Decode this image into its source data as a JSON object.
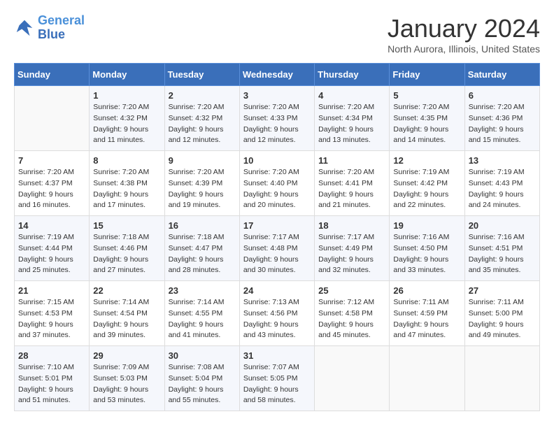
{
  "logo": {
    "line1": "General",
    "line2": "Blue"
  },
  "title": "January 2024",
  "location": "North Aurora, Illinois, United States",
  "days_header": [
    "Sunday",
    "Monday",
    "Tuesday",
    "Wednesday",
    "Thursday",
    "Friday",
    "Saturday"
  ],
  "weeks": [
    [
      {
        "num": "",
        "sunrise": "",
        "sunset": "",
        "daylight": ""
      },
      {
        "num": "1",
        "sunrise": "Sunrise: 7:20 AM",
        "sunset": "Sunset: 4:32 PM",
        "daylight": "Daylight: 9 hours and 11 minutes."
      },
      {
        "num": "2",
        "sunrise": "Sunrise: 7:20 AM",
        "sunset": "Sunset: 4:32 PM",
        "daylight": "Daylight: 9 hours and 12 minutes."
      },
      {
        "num": "3",
        "sunrise": "Sunrise: 7:20 AM",
        "sunset": "Sunset: 4:33 PM",
        "daylight": "Daylight: 9 hours and 12 minutes."
      },
      {
        "num": "4",
        "sunrise": "Sunrise: 7:20 AM",
        "sunset": "Sunset: 4:34 PM",
        "daylight": "Daylight: 9 hours and 13 minutes."
      },
      {
        "num": "5",
        "sunrise": "Sunrise: 7:20 AM",
        "sunset": "Sunset: 4:35 PM",
        "daylight": "Daylight: 9 hours and 14 minutes."
      },
      {
        "num": "6",
        "sunrise": "Sunrise: 7:20 AM",
        "sunset": "Sunset: 4:36 PM",
        "daylight": "Daylight: 9 hours and 15 minutes."
      }
    ],
    [
      {
        "num": "7",
        "sunrise": "Sunrise: 7:20 AM",
        "sunset": "Sunset: 4:37 PM",
        "daylight": "Daylight: 9 hours and 16 minutes."
      },
      {
        "num": "8",
        "sunrise": "Sunrise: 7:20 AM",
        "sunset": "Sunset: 4:38 PM",
        "daylight": "Daylight: 9 hours and 17 minutes."
      },
      {
        "num": "9",
        "sunrise": "Sunrise: 7:20 AM",
        "sunset": "Sunset: 4:39 PM",
        "daylight": "Daylight: 9 hours and 19 minutes."
      },
      {
        "num": "10",
        "sunrise": "Sunrise: 7:20 AM",
        "sunset": "Sunset: 4:40 PM",
        "daylight": "Daylight: 9 hours and 20 minutes."
      },
      {
        "num": "11",
        "sunrise": "Sunrise: 7:20 AM",
        "sunset": "Sunset: 4:41 PM",
        "daylight": "Daylight: 9 hours and 21 minutes."
      },
      {
        "num": "12",
        "sunrise": "Sunrise: 7:19 AM",
        "sunset": "Sunset: 4:42 PM",
        "daylight": "Daylight: 9 hours and 22 minutes."
      },
      {
        "num": "13",
        "sunrise": "Sunrise: 7:19 AM",
        "sunset": "Sunset: 4:43 PM",
        "daylight": "Daylight: 9 hours and 24 minutes."
      }
    ],
    [
      {
        "num": "14",
        "sunrise": "Sunrise: 7:19 AM",
        "sunset": "Sunset: 4:44 PM",
        "daylight": "Daylight: 9 hours and 25 minutes."
      },
      {
        "num": "15",
        "sunrise": "Sunrise: 7:18 AM",
        "sunset": "Sunset: 4:46 PM",
        "daylight": "Daylight: 9 hours and 27 minutes."
      },
      {
        "num": "16",
        "sunrise": "Sunrise: 7:18 AM",
        "sunset": "Sunset: 4:47 PM",
        "daylight": "Daylight: 9 hours and 28 minutes."
      },
      {
        "num": "17",
        "sunrise": "Sunrise: 7:17 AM",
        "sunset": "Sunset: 4:48 PM",
        "daylight": "Daylight: 9 hours and 30 minutes."
      },
      {
        "num": "18",
        "sunrise": "Sunrise: 7:17 AM",
        "sunset": "Sunset: 4:49 PM",
        "daylight": "Daylight: 9 hours and 32 minutes."
      },
      {
        "num": "19",
        "sunrise": "Sunrise: 7:16 AM",
        "sunset": "Sunset: 4:50 PM",
        "daylight": "Daylight: 9 hours and 33 minutes."
      },
      {
        "num": "20",
        "sunrise": "Sunrise: 7:16 AM",
        "sunset": "Sunset: 4:51 PM",
        "daylight": "Daylight: 9 hours and 35 minutes."
      }
    ],
    [
      {
        "num": "21",
        "sunrise": "Sunrise: 7:15 AM",
        "sunset": "Sunset: 4:53 PM",
        "daylight": "Daylight: 9 hours and 37 minutes."
      },
      {
        "num": "22",
        "sunrise": "Sunrise: 7:14 AM",
        "sunset": "Sunset: 4:54 PM",
        "daylight": "Daylight: 9 hours and 39 minutes."
      },
      {
        "num": "23",
        "sunrise": "Sunrise: 7:14 AM",
        "sunset": "Sunset: 4:55 PM",
        "daylight": "Daylight: 9 hours and 41 minutes."
      },
      {
        "num": "24",
        "sunrise": "Sunrise: 7:13 AM",
        "sunset": "Sunset: 4:56 PM",
        "daylight": "Daylight: 9 hours and 43 minutes."
      },
      {
        "num": "25",
        "sunrise": "Sunrise: 7:12 AM",
        "sunset": "Sunset: 4:58 PM",
        "daylight": "Daylight: 9 hours and 45 minutes."
      },
      {
        "num": "26",
        "sunrise": "Sunrise: 7:11 AM",
        "sunset": "Sunset: 4:59 PM",
        "daylight": "Daylight: 9 hours and 47 minutes."
      },
      {
        "num": "27",
        "sunrise": "Sunrise: 7:11 AM",
        "sunset": "Sunset: 5:00 PM",
        "daylight": "Daylight: 9 hours and 49 minutes."
      }
    ],
    [
      {
        "num": "28",
        "sunrise": "Sunrise: 7:10 AM",
        "sunset": "Sunset: 5:01 PM",
        "daylight": "Daylight: 9 hours and 51 minutes."
      },
      {
        "num": "29",
        "sunrise": "Sunrise: 7:09 AM",
        "sunset": "Sunset: 5:03 PM",
        "daylight": "Daylight: 9 hours and 53 minutes."
      },
      {
        "num": "30",
        "sunrise": "Sunrise: 7:08 AM",
        "sunset": "Sunset: 5:04 PM",
        "daylight": "Daylight: 9 hours and 55 minutes."
      },
      {
        "num": "31",
        "sunrise": "Sunrise: 7:07 AM",
        "sunset": "Sunset: 5:05 PM",
        "daylight": "Daylight: 9 hours and 58 minutes."
      },
      {
        "num": "",
        "sunrise": "",
        "sunset": "",
        "daylight": ""
      },
      {
        "num": "",
        "sunrise": "",
        "sunset": "",
        "daylight": ""
      },
      {
        "num": "",
        "sunrise": "",
        "sunset": "",
        "daylight": ""
      }
    ]
  ]
}
